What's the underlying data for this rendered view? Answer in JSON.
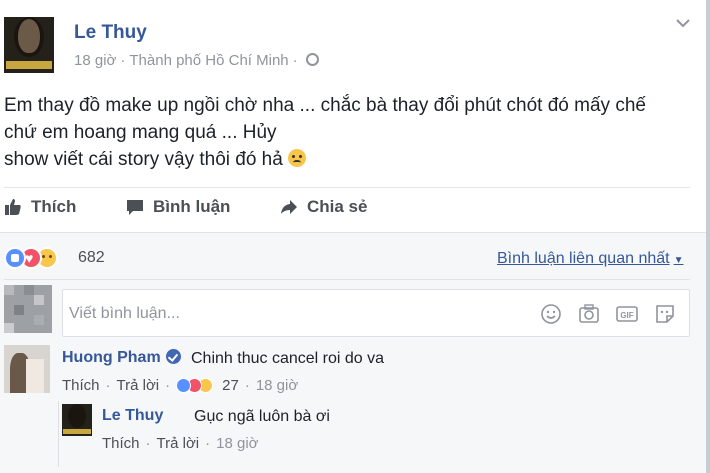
{
  "post": {
    "author": "Le Thuy",
    "time": "18 giờ",
    "separator": "·",
    "location": "Thành phố Hồ Chí Minh",
    "text_lines": [
      "Em thay đồ make up ngồi chờ nha ... chắc bà thay đổi phút chót đó mấy chế",
      "chứ em hoang mang quá ... Hủy",
      "show viết cái story vậy thôi đó hả"
    ],
    "icons": {
      "privacy": "globe-icon",
      "options": "chevron-down-icon",
      "emoji": "tired-face-emoji"
    }
  },
  "actions": {
    "like": "Thích",
    "comment": "Bình luận",
    "share": "Chia sẻ"
  },
  "reactions": {
    "types": [
      "like",
      "love",
      "sad"
    ],
    "count": "682",
    "colors": {
      "like": "#5890ff",
      "love": "#f25268",
      "sad": "#f7c64a"
    }
  },
  "sort": {
    "label": "Bình luận liên quan nhất",
    "caret": "▼"
  },
  "composer": {
    "placeholder": "Viết bình luận...",
    "icons": [
      "emoji-icon",
      "camera-icon",
      "gif-icon",
      "sticker-icon"
    ]
  },
  "comments": [
    {
      "author": "Huong Pham",
      "verified": true,
      "text": "Chinh thuc cancel roi do va",
      "like_label": "Thích",
      "reply_label": "Trả lời",
      "reaction_count": "27",
      "time": "18 giờ",
      "replies": [
        {
          "author": "Le Thuy",
          "text": "Gục ngã luôn bà ơi",
          "like_label": "Thích",
          "reply_label": "Trả lời",
          "time": "18 giờ"
        }
      ]
    }
  ],
  "colors": {
    "link": "#365899",
    "text": "#1d2129",
    "muted": "#90949c",
    "comment_bg": "#f6f7f9"
  }
}
